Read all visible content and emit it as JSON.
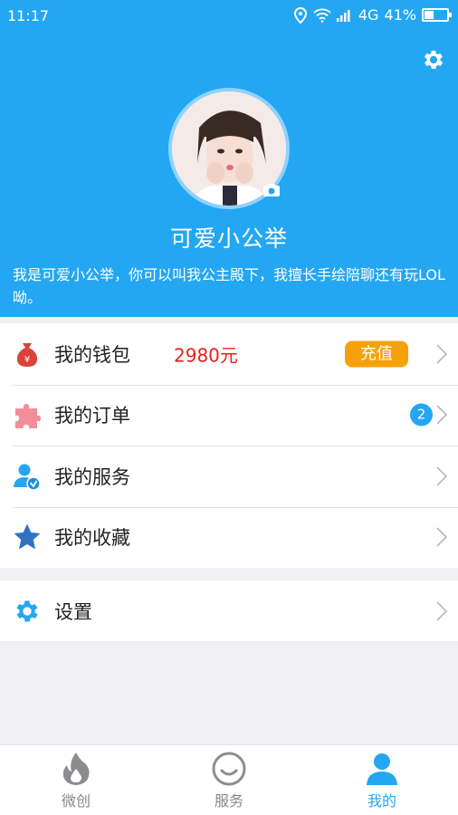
{
  "status": {
    "time": "11:17",
    "network": "4G",
    "battery_percent": "41%",
    "battery_level": 0.41
  },
  "profile": {
    "nickname": "可爱小公举",
    "bio": "我是可爱小公举，你可以叫我公主殿下，我擅长手绘陪聊还有玩LOL呦。"
  },
  "menu": {
    "wallet": {
      "label": "我的钱包",
      "amount": "2980元",
      "action": "充值"
    },
    "orders": {
      "label": "我的订单",
      "badge": "2"
    },
    "services": {
      "label": "我的服务"
    },
    "favorites": {
      "label": "我的收藏"
    },
    "settings": {
      "label": "设置"
    }
  },
  "nav": [
    {
      "label": "微创",
      "icon": "flame-icon",
      "active": false
    },
    {
      "label": "服务",
      "icon": "smile-circle-icon",
      "active": false
    },
    {
      "label": "我的",
      "icon": "person-icon",
      "active": true
    }
  ],
  "colors": {
    "primary": "#24a7f2",
    "accent": "#f7a10a",
    "amount": "#e8211a",
    "background": "#f0f0f2"
  }
}
